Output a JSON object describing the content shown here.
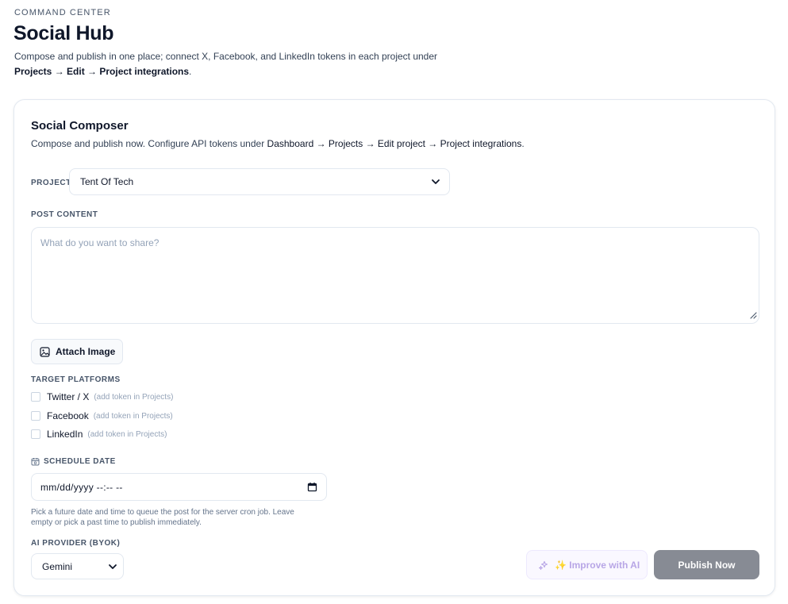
{
  "header": {
    "eyebrow": "COMMAND CENTER",
    "title": "Social Hub",
    "description": "Compose and publish in one place; connect X, Facebook, and LinkedIn tokens in each project under",
    "path": "Projects → Edit → Project integrations",
    "path_end": "."
  },
  "composer": {
    "title": "Social Composer",
    "description": "Compose and publish now. Configure API tokens under",
    "path": "Dashboard → Projects → Edit project → Project integrations",
    "path_end": ".",
    "project": {
      "label": "PROJECT",
      "selected": "Tent Of Tech"
    },
    "content": {
      "label": "POST CONTENT",
      "placeholder": "What do you want to share?"
    },
    "attach_label": "Attach Image",
    "platforms": {
      "label": "TARGET PLATFORMS",
      "items": [
        {
          "name": "Twitter / X",
          "hint": "(add token in Projects)",
          "checked": false
        },
        {
          "name": "Facebook",
          "hint": "(add token in Projects)",
          "checked": false
        },
        {
          "name": "LinkedIn",
          "hint": "(add token in Projects)",
          "checked": false
        }
      ]
    },
    "schedule": {
      "label": "SCHEDULE DATE",
      "value": "mm/dd/yyyy --:-- --",
      "help": "Pick a future date and time to queue the post for the server cron job. Leave empty or pick a past time to publish immediately."
    },
    "ai": {
      "label": "AI PROVIDER (BYOK)",
      "selected": "Gemini"
    },
    "improve_label": "✨ Improve with AI",
    "publish_label": "Publish Now"
  },
  "colors": {
    "text": "#0f172a",
    "muted": "#475569",
    "border": "#e2e8f0",
    "improve_text": "#b8a6e6",
    "publish_bg": "#878b94"
  },
  "icons": {
    "project_chevron": "chevron-down-icon",
    "attach": "image-icon",
    "schedule": "calendar-icon",
    "date_picker": "calendar-icon",
    "ai_chevron": "chevron-down-icon",
    "improve": "sparkles-icon",
    "resize": "resize-handle-icon"
  }
}
